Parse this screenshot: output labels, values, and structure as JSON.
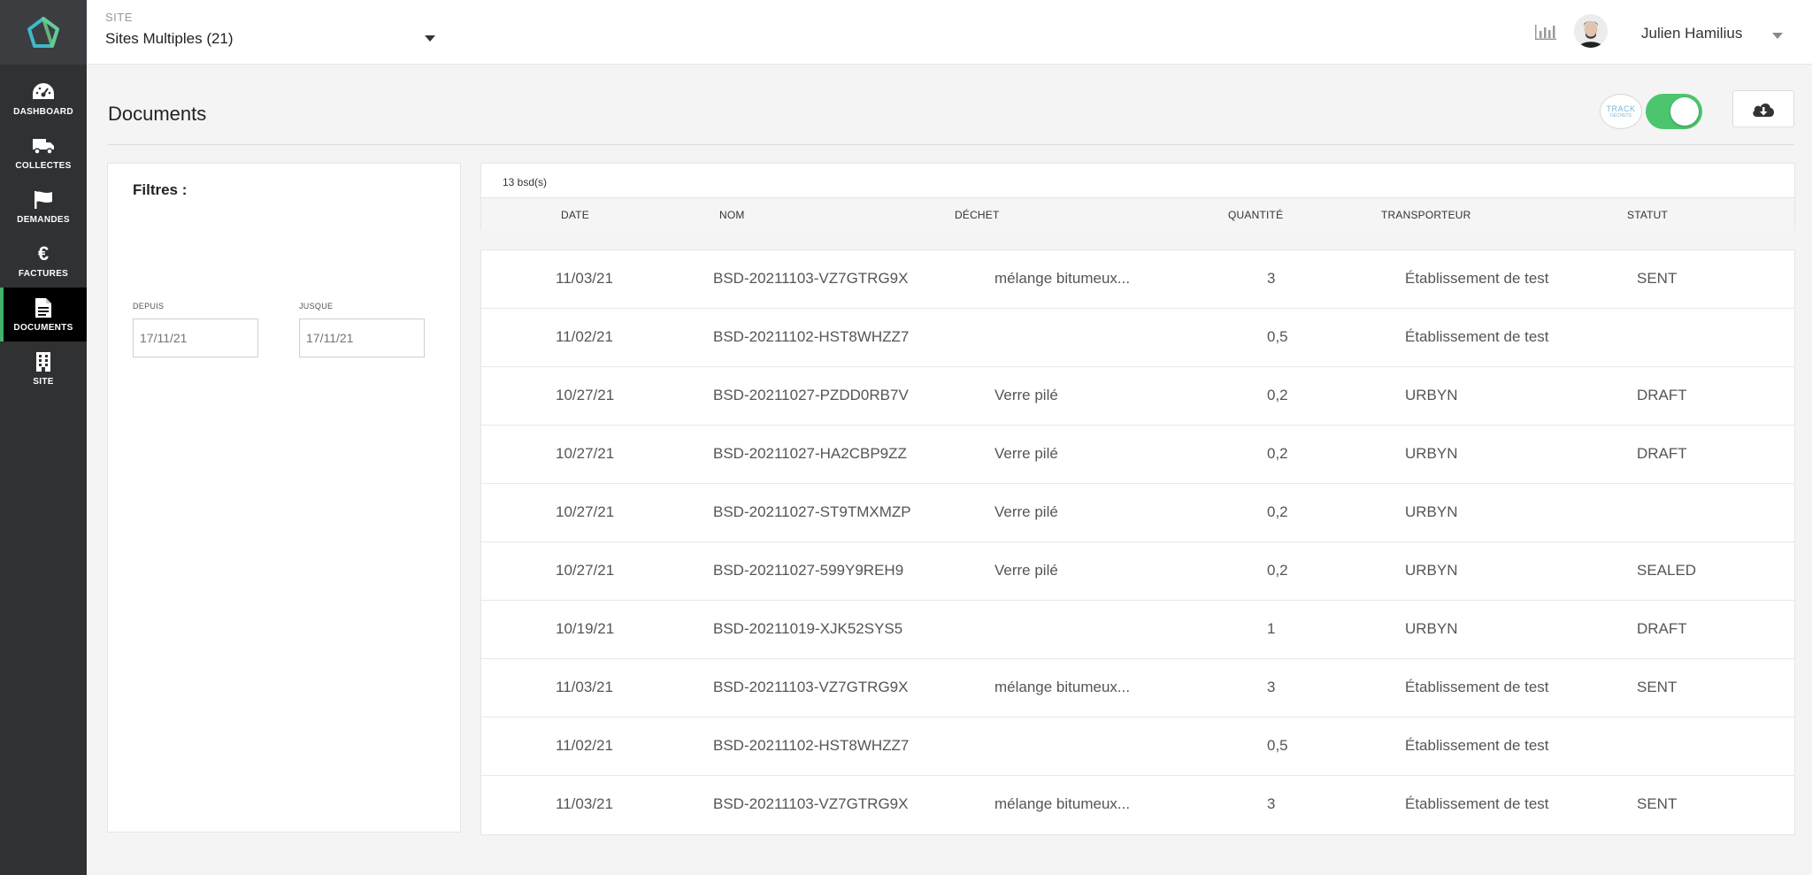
{
  "sidebar": {
    "items": [
      {
        "label": "DASHBOARD",
        "icon": "dashboard-icon"
      },
      {
        "label": "COLLECTES",
        "icon": "truck-icon"
      },
      {
        "label": "DEMANDES",
        "icon": "flag-icon"
      },
      {
        "label": "FACTURES",
        "icon": "euro-icon",
        "glyph": "€"
      },
      {
        "label": "DOCUMENTS",
        "icon": "document-icon",
        "active": true
      },
      {
        "label": "SITE",
        "icon": "building-icon"
      }
    ]
  },
  "header": {
    "site_label": "SITE",
    "site_value": "Sites Multiples (21)",
    "user_name": "Julien Hamilius"
  },
  "page": {
    "title": "Documents",
    "track_logo": {
      "line1": "TRACK",
      "line2": "DÉCHETS"
    }
  },
  "filters": {
    "title": "Filtres :",
    "since_label": "DEPUIS",
    "until_label": "JUSQUE",
    "since_placeholder": "17/11/21",
    "until_placeholder": "17/11/21"
  },
  "table": {
    "count": "13 bsd(s)",
    "columns": [
      "DATE",
      "NOM",
      "DÉCHET",
      "QUANTITÉ",
      "TRANSPORTEUR",
      "STATUT"
    ],
    "rows": [
      [
        "11/03/21",
        "BSD-20211103-VZ7GTRG9X",
        "mélange bitumeux...",
        "3",
        "Établissement de test",
        "SENT"
      ],
      [
        "11/02/21",
        "BSD-20211102-HST8WHZZ7",
        "",
        "0,5",
        "Établissement de test",
        ""
      ],
      [
        "10/27/21",
        "BSD-20211027-PZDD0RB7V",
        "Verre pilé",
        "0,2",
        "URBYN",
        "DRAFT"
      ],
      [
        "10/27/21",
        "BSD-20211027-HA2CBP9ZZ",
        "Verre pilé",
        "0,2",
        "URBYN",
        "DRAFT"
      ],
      [
        "10/27/21",
        "BSD-20211027-ST9TMXMZP",
        "Verre pilé",
        "0,2",
        "URBYN",
        ""
      ],
      [
        "10/27/21",
        "BSD-20211027-599Y9REH9",
        "Verre pilé",
        "0,2",
        "URBYN",
        "SEALED"
      ],
      [
        "10/19/21",
        "BSD-20211019-XJK52SYS5",
        "",
        "1",
        "URBYN",
        "DRAFT"
      ],
      [
        "11/03/21",
        "BSD-20211103-VZ7GTRG9X",
        "mélange bitumeux...",
        "3",
        "Établissement de test",
        "SENT"
      ],
      [
        "11/02/21",
        "BSD-20211102-HST8WHZZ7",
        "",
        "0,5",
        "Établissement de test",
        ""
      ],
      [
        "11/03/21",
        "BSD-20211103-VZ7GTRG9X",
        "mélange bitumeux...",
        "3",
        "Établissement de test",
        "SENT"
      ]
    ]
  },
  "colors": {
    "sidebar_bg": "#2f3133",
    "active_accent": "#3fb36b",
    "toggle_on": "#4cc66e",
    "logo_teal": "#3fb8c9"
  }
}
